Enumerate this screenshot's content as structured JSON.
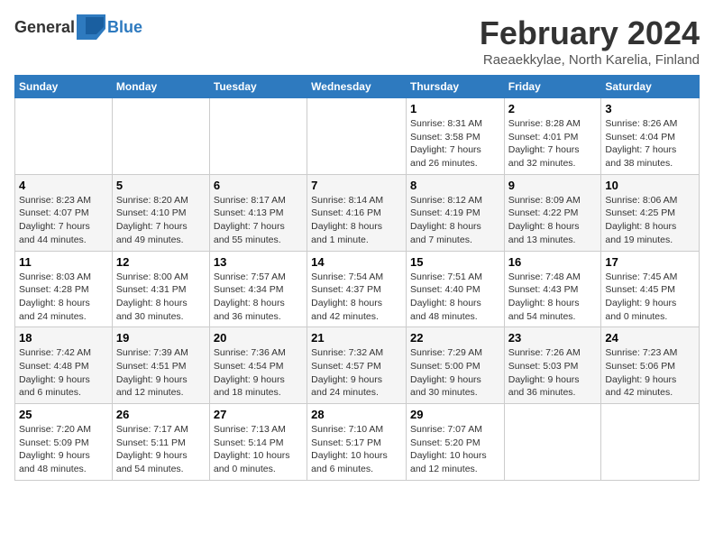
{
  "header": {
    "logo_general": "General",
    "logo_blue": "Blue",
    "title": "February 2024",
    "subtitle": "Raeaekkylae, North Karelia, Finland"
  },
  "weekdays": [
    "Sunday",
    "Monday",
    "Tuesday",
    "Wednesday",
    "Thursday",
    "Friday",
    "Saturday"
  ],
  "weeks": [
    [
      {
        "day": "",
        "info": ""
      },
      {
        "day": "",
        "info": ""
      },
      {
        "day": "",
        "info": ""
      },
      {
        "day": "",
        "info": ""
      },
      {
        "day": "1",
        "info": "Sunrise: 8:31 AM\nSunset: 3:58 PM\nDaylight: 7 hours\nand 26 minutes."
      },
      {
        "day": "2",
        "info": "Sunrise: 8:28 AM\nSunset: 4:01 PM\nDaylight: 7 hours\nand 32 minutes."
      },
      {
        "day": "3",
        "info": "Sunrise: 8:26 AM\nSunset: 4:04 PM\nDaylight: 7 hours\nand 38 minutes."
      }
    ],
    [
      {
        "day": "4",
        "info": "Sunrise: 8:23 AM\nSunset: 4:07 PM\nDaylight: 7 hours\nand 44 minutes."
      },
      {
        "day": "5",
        "info": "Sunrise: 8:20 AM\nSunset: 4:10 PM\nDaylight: 7 hours\nand 49 minutes."
      },
      {
        "day": "6",
        "info": "Sunrise: 8:17 AM\nSunset: 4:13 PM\nDaylight: 7 hours\nand 55 minutes."
      },
      {
        "day": "7",
        "info": "Sunrise: 8:14 AM\nSunset: 4:16 PM\nDaylight: 8 hours\nand 1 minute."
      },
      {
        "day": "8",
        "info": "Sunrise: 8:12 AM\nSunset: 4:19 PM\nDaylight: 8 hours\nand 7 minutes."
      },
      {
        "day": "9",
        "info": "Sunrise: 8:09 AM\nSunset: 4:22 PM\nDaylight: 8 hours\nand 13 minutes."
      },
      {
        "day": "10",
        "info": "Sunrise: 8:06 AM\nSunset: 4:25 PM\nDaylight: 8 hours\nand 19 minutes."
      }
    ],
    [
      {
        "day": "11",
        "info": "Sunrise: 8:03 AM\nSunset: 4:28 PM\nDaylight: 8 hours\nand 24 minutes."
      },
      {
        "day": "12",
        "info": "Sunrise: 8:00 AM\nSunset: 4:31 PM\nDaylight: 8 hours\nand 30 minutes."
      },
      {
        "day": "13",
        "info": "Sunrise: 7:57 AM\nSunset: 4:34 PM\nDaylight: 8 hours\nand 36 minutes."
      },
      {
        "day": "14",
        "info": "Sunrise: 7:54 AM\nSunset: 4:37 PM\nDaylight: 8 hours\nand 42 minutes."
      },
      {
        "day": "15",
        "info": "Sunrise: 7:51 AM\nSunset: 4:40 PM\nDaylight: 8 hours\nand 48 minutes."
      },
      {
        "day": "16",
        "info": "Sunrise: 7:48 AM\nSunset: 4:43 PM\nDaylight: 8 hours\nand 54 minutes."
      },
      {
        "day": "17",
        "info": "Sunrise: 7:45 AM\nSunset: 4:45 PM\nDaylight: 9 hours\nand 0 minutes."
      }
    ],
    [
      {
        "day": "18",
        "info": "Sunrise: 7:42 AM\nSunset: 4:48 PM\nDaylight: 9 hours\nand 6 minutes."
      },
      {
        "day": "19",
        "info": "Sunrise: 7:39 AM\nSunset: 4:51 PM\nDaylight: 9 hours\nand 12 minutes."
      },
      {
        "day": "20",
        "info": "Sunrise: 7:36 AM\nSunset: 4:54 PM\nDaylight: 9 hours\nand 18 minutes."
      },
      {
        "day": "21",
        "info": "Sunrise: 7:32 AM\nSunset: 4:57 PM\nDaylight: 9 hours\nand 24 minutes."
      },
      {
        "day": "22",
        "info": "Sunrise: 7:29 AM\nSunset: 5:00 PM\nDaylight: 9 hours\nand 30 minutes."
      },
      {
        "day": "23",
        "info": "Sunrise: 7:26 AM\nSunset: 5:03 PM\nDaylight: 9 hours\nand 36 minutes."
      },
      {
        "day": "24",
        "info": "Sunrise: 7:23 AM\nSunset: 5:06 PM\nDaylight: 9 hours\nand 42 minutes."
      }
    ],
    [
      {
        "day": "25",
        "info": "Sunrise: 7:20 AM\nSunset: 5:09 PM\nDaylight: 9 hours\nand 48 minutes."
      },
      {
        "day": "26",
        "info": "Sunrise: 7:17 AM\nSunset: 5:11 PM\nDaylight: 9 hours\nand 54 minutes."
      },
      {
        "day": "27",
        "info": "Sunrise: 7:13 AM\nSunset: 5:14 PM\nDaylight: 10 hours\nand 0 minutes."
      },
      {
        "day": "28",
        "info": "Sunrise: 7:10 AM\nSunset: 5:17 PM\nDaylight: 10 hours\nand 6 minutes."
      },
      {
        "day": "29",
        "info": "Sunrise: 7:07 AM\nSunset: 5:20 PM\nDaylight: 10 hours\nand 12 minutes."
      },
      {
        "day": "",
        "info": ""
      },
      {
        "day": "",
        "info": ""
      }
    ]
  ]
}
